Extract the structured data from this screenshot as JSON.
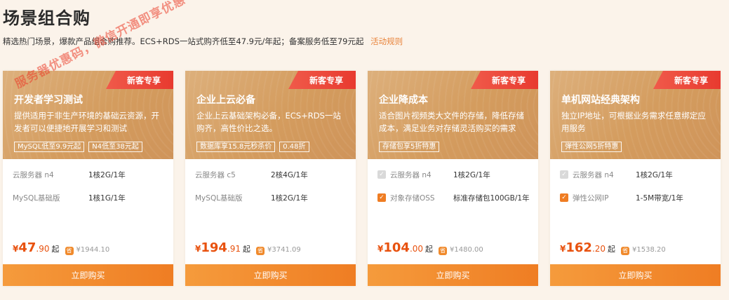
{
  "header": {
    "title": "场景组合购",
    "subtitle": "精选热门场景，爆款产品组合购推荐。ECS+RDS一站式购齐低至47.9元/年起；备案服务低至79元起",
    "rules_link": "活动规则"
  },
  "colors": {
    "accent": "#ef7d23",
    "price": "#e8520f",
    "badge": "#e83a2f",
    "card_head": "#d49c5e"
  },
  "watermark": "服务器优惠码，微信开通即享优惠",
  "cards": [
    {
      "badge": "新客专享",
      "title": "开发者学习测试",
      "desc": "提供适用于非生产环境的基础云资源，开发者可以便捷地开展学习和测试",
      "tags": [
        "MySQL低至9.9元起",
        "N4低至38元起"
      ],
      "specs": [
        {
          "name": "云服务器 n4",
          "value": "1核2G/1年",
          "checkbox": "none"
        },
        {
          "name": "MySQL基础版",
          "value": "1核1G/1年",
          "checkbox": "none"
        }
      ],
      "currency": "¥",
      "price_int": "47",
      "price_dec": ".90",
      "price_unit": "起",
      "orig_icon": "省",
      "orig_price": "¥1944.10",
      "buy_label": "立即购买"
    },
    {
      "badge": "新客专享",
      "title": "企业上云必备",
      "desc": "企业上云基础架构必备，ECS+RDS一站购齐，高性价比之选。",
      "tags": [
        "数据库享15.8元秒杀价",
        "0.48折"
      ],
      "specs": [
        {
          "name": "云服务器 c5",
          "value": "2核4G/1年",
          "checkbox": "none"
        },
        {
          "name": "MySQL基础版",
          "value": "1核2G/1年",
          "checkbox": "none"
        }
      ],
      "currency": "¥",
      "price_int": "194",
      "price_dec": ".91",
      "price_unit": "起",
      "orig_icon": "省",
      "orig_price": "¥3741.09",
      "buy_label": "立即购买"
    },
    {
      "badge": "新客专享",
      "title": "企业降成本",
      "desc": "适合图片视频类大文件的存储，降低存储成本，满足业务对存储灵活购买的需求",
      "tags": [
        "存储包享5折特惠"
      ],
      "specs": [
        {
          "name": "云服务器 n4",
          "value": "1核2G/1年",
          "checkbox": "disabled"
        },
        {
          "name": "对象存储OSS",
          "value": "标准存储包100GB/1年",
          "checkbox": "checked"
        }
      ],
      "currency": "¥",
      "price_int": "104",
      "price_dec": ".00",
      "price_unit": "起",
      "orig_icon": "省",
      "orig_price": "¥1480.00",
      "buy_label": "立即购买"
    },
    {
      "badge": "新客专享",
      "title": "单机网站经典架构",
      "desc": "独立IP地址，可根据业务需求任意绑定应用服务",
      "tags": [
        "弹性公网5折特惠"
      ],
      "specs": [
        {
          "name": "云服务器 n4",
          "value": "1核2G/1年",
          "checkbox": "disabled"
        },
        {
          "name": "弹性公网IP",
          "value": "1-5M带宽/1年",
          "checkbox": "checked"
        }
      ],
      "currency": "¥",
      "price_int": "162",
      "price_dec": ".20",
      "price_unit": "起",
      "orig_icon": "省",
      "orig_price": "¥1538.20",
      "buy_label": "立即购买"
    }
  ]
}
